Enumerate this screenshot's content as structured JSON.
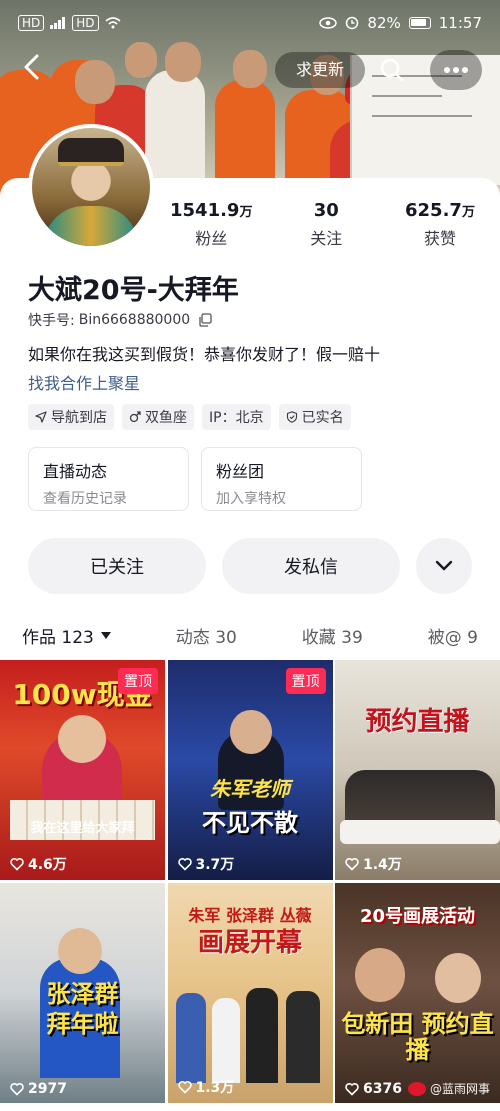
{
  "status_bar": {
    "left_badges": [
      "HD",
      "HD"
    ],
    "battery": "82%",
    "time": "11:57"
  },
  "nav": {
    "back_icon": "chevron-left-icon",
    "refresh_label": "求更新",
    "search_icon": "search-icon",
    "more_icon": "more-dots-icon"
  },
  "profile": {
    "stats": [
      {
        "value": "1541.9",
        "unit": "万",
        "label": "粉丝"
      },
      {
        "value": "30",
        "unit": "",
        "label": "关注"
      },
      {
        "value": "625.7",
        "unit": "万",
        "label": "获赞"
      }
    ],
    "nickname": "大斌20号-大拜年",
    "handle_label": "快手号: ",
    "handle_value": "Bin6668880000",
    "bio": "如果你在我这买到假货！恭喜你发财了！假一赔十",
    "bio_link": "找我合作上聚星",
    "tags": [
      {
        "icon": "navigation-icon",
        "label": "导航到店"
      },
      {
        "icon": "male-icon",
        "label": "双鱼座"
      },
      {
        "icon": "",
        "label": "IP：北京"
      },
      {
        "icon": "verified-shield-icon",
        "label": "已实名"
      }
    ],
    "boxes": [
      {
        "title": "直播动态",
        "subtitle": "查看历史记录"
      },
      {
        "title": "粉丝团",
        "subtitle": "加入享特权"
      }
    ],
    "actions": {
      "follow": "已关注",
      "message": "发私信",
      "expand_icon": "chevron-down-icon"
    }
  },
  "tabs": [
    {
      "label": "作品 123",
      "active": true
    },
    {
      "label": "动态 30",
      "active": false
    },
    {
      "label": "收藏 39",
      "active": false
    },
    {
      "label": "被@ 9",
      "active": false
    }
  ],
  "videos": [
    {
      "pinned": "置顶",
      "caption_top": "100w现金",
      "caption_bottom": "我在这里给大家拜",
      "likes": "4.6万"
    },
    {
      "pinned": "置顶",
      "caption_top": "朱军老师",
      "caption_bottom": "不见不散",
      "likes": "3.7万"
    },
    {
      "pinned": "",
      "caption_top": "预约直播",
      "caption_bottom": "",
      "likes": "1.4万"
    },
    {
      "pinned": "",
      "caption_top": "张泽群",
      "caption_bottom": "拜年啦",
      "likes": "2977"
    },
    {
      "pinned": "",
      "caption_top": "朱军 张泽群 丛薇",
      "caption_bottom": "画展开幕",
      "likes": "1.3万"
    },
    {
      "pinned": "",
      "caption_top": "20号画展活动",
      "caption_bottom": "包新田 预约直播",
      "likes": "6376"
    }
  ],
  "watermark": "@蓝雨网事",
  "colors": {
    "accent": "#fe2c55",
    "link": "#3f5d8c"
  }
}
